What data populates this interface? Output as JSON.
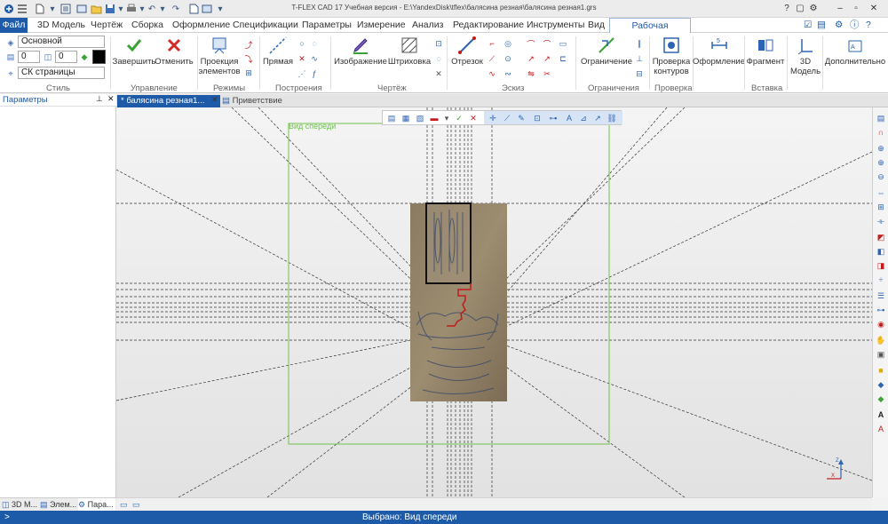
{
  "window": {
    "title": "T-FLEX CAD 17 Учебная версия - E:\\YandexDisk\\tflex\\балясина резная\\балясина резная1.grs"
  },
  "menu": {
    "file": "Файл",
    "items": [
      "3D Модель",
      "Чертёж",
      "Сборка",
      "Оформление",
      "Спецификации",
      "Параметры",
      "Измерение",
      "Анализ",
      "Редактирование",
      "Инструменты",
      "Вид"
    ],
    "active": "Рабочая плоскость"
  },
  "ribbon": {
    "style": {
      "layer_value": "Основной",
      "num1": "0",
      "num2": "0",
      "cs_value": "СК страницы",
      "color": "#000000",
      "label": "Стиль"
    },
    "control": {
      "finish": "Завершить",
      "cancel": "Отменить",
      "label": "Управление"
    },
    "modes": {
      "projection": "Проекция элементов",
      "label": "Режимы"
    },
    "constructions": {
      "line": "Прямая",
      "label": "Построения"
    },
    "drawing": {
      "image": "Изображение",
      "hatch": "Штриховка",
      "label": "Чертёж"
    },
    "sketch": {
      "segment": "Отрезок",
      "label": "Эскиз"
    },
    "constraints": {
      "constraint": "Ограничение",
      "label": "Ограничения"
    },
    "check": {
      "contours": "Проверка контуров",
      "label": "Проверка"
    },
    "design": {
      "label": "Оформление"
    },
    "insert": {
      "fragment": "Фрагмент",
      "label": "Вставка"
    },
    "model": {
      "label": "3D Модель"
    },
    "extra": {
      "label": "Дополнительно"
    }
  },
  "panel": {
    "title": "Параметры"
  },
  "tabs": {
    "document": "* балясина резная1...",
    "welcome": "Приветствие"
  },
  "canvas": {
    "view_label": "Вид спереди",
    "frame_color": "#6fc24a",
    "sketch_color": "#c41a1a"
  },
  "bottom_tabs": [
    "3D М...",
    "Элем...",
    "Пара..."
  ],
  "status": {
    "prompt": ">",
    "selected": "Выбрано: Вид спереди"
  },
  "colors": {
    "accent": "#1d5aa8"
  }
}
